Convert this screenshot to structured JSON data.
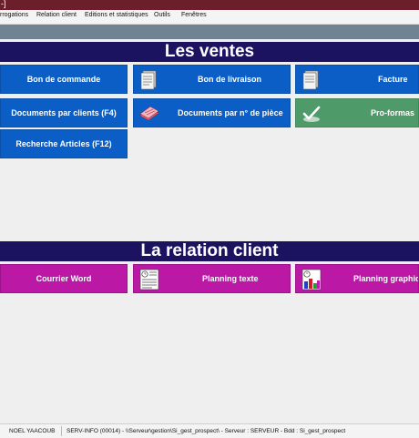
{
  "window": {
    "title_fragment": "-]"
  },
  "menu": {
    "items": [
      "rrogations",
      "Relation client",
      "Editions et statistiques",
      "Outils",
      "Fenêtres"
    ]
  },
  "sections": {
    "ventes": {
      "title": "Les ventes",
      "tiles": [
        "Bon de commande",
        "Bon de livraison",
        "Facture",
        "Documents par clients (F4)",
        "Documents par n° de pièce",
        "Pro-formas",
        "Recherche Articles (F12)"
      ]
    },
    "relation": {
      "title": "La relation client",
      "tiles": [
        "Courrier Word",
        "Planning texte",
        "Planning graphiq"
      ]
    }
  },
  "status": {
    "user": "NOEL YAACOUB",
    "info": "SERV-INFO (00014) - \\\\Serveur\\gestion\\Si_gest_prospect\\ - Serveur : SERVEUR - Bdd : Si_gest_prospect"
  },
  "colors": {
    "titlebar": "#6b1f2a",
    "section_header": "#1b1360",
    "tile_blue": "#0a5ec6",
    "tile_green": "#4e9a68",
    "tile_magenta": "#bb18a6"
  }
}
